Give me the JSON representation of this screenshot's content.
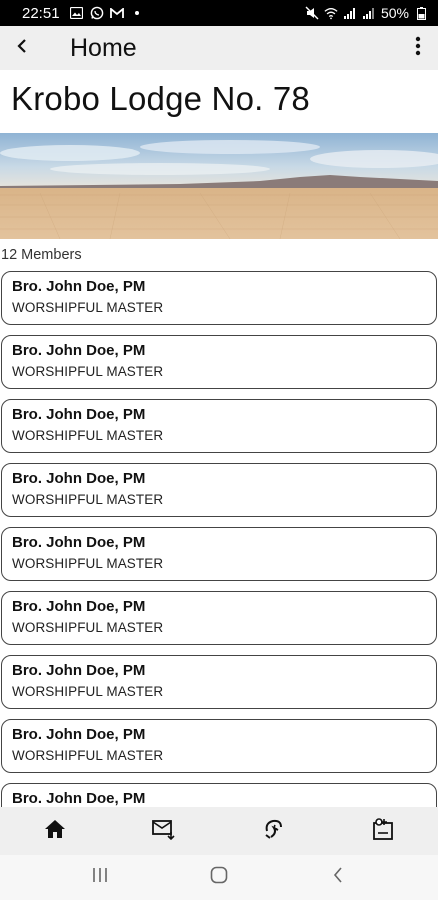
{
  "status_bar": {
    "time": "22:51",
    "battery_percent": "50%",
    "icons_left": [
      "gallery-icon",
      "whatsapp-icon",
      "gmail-icon",
      "dot-icon"
    ],
    "icons_right": [
      "mute-icon",
      "wifi-icon",
      "signal-icon",
      "signal-icon",
      "battery-icon"
    ]
  },
  "app_bar": {
    "title": "Home",
    "back_icon": "back-arrow-icon",
    "menu_icon": "more-vert-icon"
  },
  "lodge": {
    "name": "Krobo Lodge No. 78",
    "banner_alt": "desert landscape"
  },
  "members": {
    "count_label": "12 Members",
    "items": [
      {
        "name": "Bro. John Doe, PM",
        "role": "WORSHIPFUL MASTER"
      },
      {
        "name": "Bro. John Doe, PM",
        "role": "WORSHIPFUL MASTER"
      },
      {
        "name": "Bro. John Doe, PM",
        "role": "WORSHIPFUL MASTER"
      },
      {
        "name": "Bro. John Doe, PM",
        "role": "WORSHIPFUL MASTER"
      },
      {
        "name": "Bro. John Doe, PM",
        "role": "WORSHIPFUL MASTER"
      },
      {
        "name": "Bro. John Doe, PM",
        "role": "WORSHIPFUL MASTER"
      },
      {
        "name": "Bro. John Doe, PM",
        "role": "WORSHIPFUL MASTER"
      },
      {
        "name": "Bro. John Doe, PM",
        "role": "WORSHIPFUL MASTER"
      },
      {
        "name": "Bro. John Doe, PM",
        "role": ""
      }
    ]
  },
  "bottom_nav": {
    "items": [
      "home-icon",
      "mail-icon",
      "payments-icon",
      "badge-icon"
    ]
  },
  "system_nav": {
    "items": [
      "recents-icon",
      "home-circle-icon",
      "back-chevron-icon"
    ]
  },
  "colors": {
    "app_bar_bg": "#efefef",
    "card_border": "#444444",
    "status_bar_bg": "#000000"
  }
}
